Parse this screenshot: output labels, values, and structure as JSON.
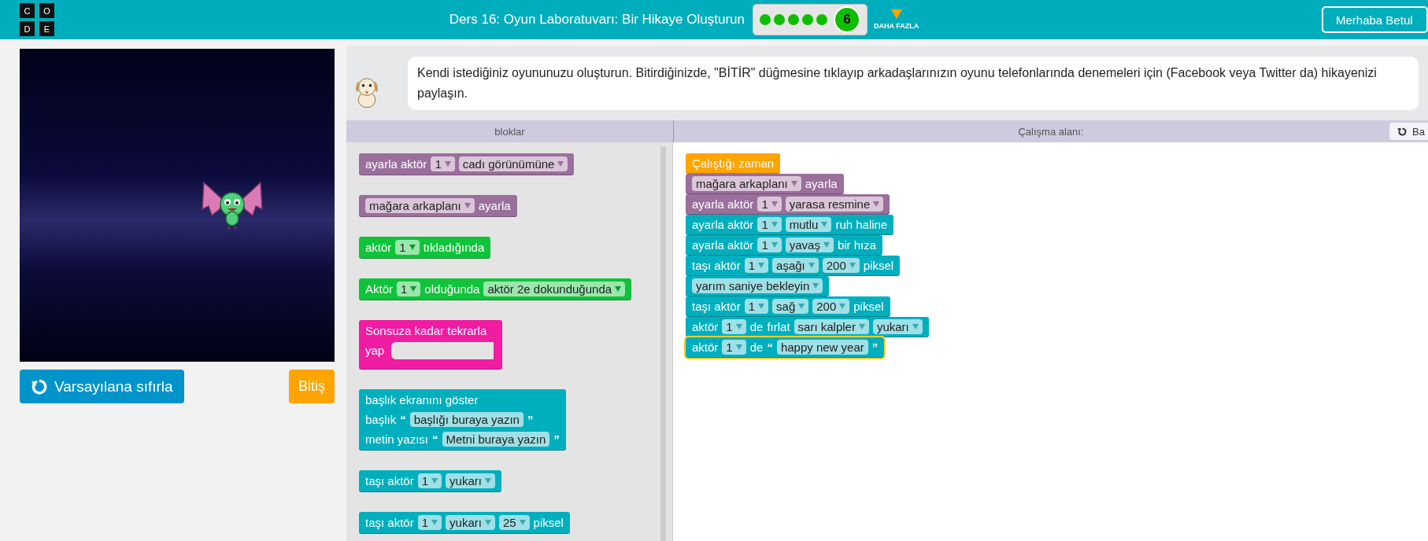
{
  "header": {
    "logo_letters": [
      "C",
      "O",
      "D",
      "E"
    ],
    "title": "Ders 16: Oyun Laboratuvarı: Bir Hikaye Oluşturun",
    "progress": {
      "dots": [
        {
          "completed": true
        },
        {
          "completed": true
        },
        {
          "completed": true
        },
        {
          "completed": true
        },
        {
          "completed": true
        }
      ],
      "current": "6"
    },
    "more_label": "DAHA FAZLA",
    "user_button": "Merhaba Betul"
  },
  "game": {
    "reset_button": "Varsayılana sıfırla",
    "finish_button": "Bitiş"
  },
  "instructions": {
    "text": "Kendi istediğiniz oyununuzu oluşturun. Bitirdiğinizde, \"BİTİR\" düğmesine tıklayıp arkadaşlarınızın oyunu telefonlarında denemeleri için (Facebook veya Twitter da) hikayenizi paylaşın."
  },
  "toolbox": {
    "title": "bloklar",
    "blocks": [
      {
        "kind": "looks",
        "lines": [
          [
            {
              "kind": "text",
              "v": "ayarla aktör"
            },
            {
              "kind": "dropdown",
              "v": "1"
            },
            {
              "kind": "dropdown",
              "v": "cadı görünümüne"
            }
          ]
        ]
      },
      {
        "kind": "looks",
        "lines": [
          [
            {
              "kind": "dropdown",
              "v": "mağara arkaplanı"
            },
            {
              "kind": "text",
              "v": "ayarla"
            }
          ]
        ]
      },
      {
        "kind": "event",
        "lines": [
          [
            {
              "kind": "text",
              "v": "aktör"
            },
            {
              "kind": "dropdown",
              "v": "1"
            },
            {
              "kind": "text",
              "v": "tıkladığında"
            }
          ]
        ]
      },
      {
        "kind": "event",
        "lines": [
          [
            {
              "kind": "text",
              "v": "Aktör"
            },
            {
              "kind": "dropdown",
              "v": "1"
            },
            {
              "kind": "text",
              "v": "olduğunda"
            },
            {
              "kind": "dropdown",
              "v": "aktör 2e dokunduğunda"
            }
          ]
        ]
      },
      {
        "kind": "loop",
        "lines": [
          [
            {
              "kind": "text",
              "v": "Sonsuza kadar tekrarla"
            }
          ],
          [
            {
              "kind": "text",
              "v": "yap"
            }
          ]
        ]
      },
      {
        "kind": "action",
        "lines": [
          [
            {
              "kind": "text",
              "v": "başlık ekranını göster"
            }
          ],
          [
            {
              "kind": "text",
              "v": "başlık"
            },
            {
              "kind": "quote",
              "v": "“"
            },
            {
              "kind": "input",
              "v": "başlığı buraya yazın"
            },
            {
              "kind": "quote",
              "v": "”"
            }
          ],
          [
            {
              "kind": "text",
              "v": "metin yazısı"
            },
            {
              "kind": "quote",
              "v": "“"
            },
            {
              "kind": "input",
              "v": "Metni buraya yazın"
            },
            {
              "kind": "quote",
              "v": "”"
            }
          ]
        ]
      },
      {
        "kind": "action",
        "lines": [
          [
            {
              "kind": "text",
              "v": "taşı aktör"
            },
            {
              "kind": "dropdown",
              "v": "1"
            },
            {
              "kind": "dropdown",
              "v": "yukarı"
            }
          ]
        ]
      },
      {
        "kind": "action",
        "lines": [
          [
            {
              "kind": "text",
              "v": "taşı aktör"
            },
            {
              "kind": "dropdown",
              "v": "1"
            },
            {
              "kind": "dropdown",
              "v": "yukarı"
            },
            {
              "kind": "dropdown",
              "v": "25"
            },
            {
              "kind": "text",
              "v": "piksel"
            }
          ]
        ]
      }
    ]
  },
  "workspace": {
    "title": "Çalışma alanı:",
    "reset_button": "Ba",
    "blocks": [
      {
        "kind": "start",
        "selected": false,
        "lines": [
          [
            {
              "kind": "text",
              "v": "Çalıştığı zaman"
            }
          ]
        ]
      },
      {
        "kind": "looks",
        "selected": false,
        "lines": [
          [
            {
              "kind": "dropdown",
              "v": "mağara arkaplanı"
            },
            {
              "kind": "text",
              "v": "ayarla"
            }
          ]
        ]
      },
      {
        "kind": "looks",
        "selected": false,
        "lines": [
          [
            {
              "kind": "text",
              "v": "ayarla aktör"
            },
            {
              "kind": "dropdown",
              "v": "1"
            },
            {
              "kind": "dropdown",
              "v": "yarasa resmine"
            }
          ]
        ]
      },
      {
        "kind": "action",
        "selected": false,
        "lines": [
          [
            {
              "kind": "text",
              "v": "ayarla aktör"
            },
            {
              "kind": "dropdown",
              "v": "1"
            },
            {
              "kind": "dropdown",
              "v": "mutlu"
            },
            {
              "kind": "text",
              "v": "ruh haline"
            }
          ]
        ]
      },
      {
        "kind": "action",
        "selected": false,
        "lines": [
          [
            {
              "kind": "text",
              "v": "ayarla aktör"
            },
            {
              "kind": "dropdown",
              "v": "1"
            },
            {
              "kind": "dropdown",
              "v": "yavaş"
            },
            {
              "kind": "text",
              "v": "bir hıza"
            }
          ]
        ]
      },
      {
        "kind": "action",
        "selected": false,
        "lines": [
          [
            {
              "kind": "text",
              "v": "taşı aktör"
            },
            {
              "kind": "dropdown",
              "v": "1"
            },
            {
              "kind": "dropdown",
              "v": "aşağı"
            },
            {
              "kind": "dropdown",
              "v": "200"
            },
            {
              "kind": "text",
              "v": "piksel"
            }
          ]
        ]
      },
      {
        "kind": "action",
        "selected": false,
        "lines": [
          [
            {
              "kind": "dropdown",
              "v": "yarım saniye bekleyin"
            }
          ]
        ]
      },
      {
        "kind": "action",
        "selected": false,
        "lines": [
          [
            {
              "kind": "text",
              "v": "taşı aktör"
            },
            {
              "kind": "dropdown",
              "v": "1"
            },
            {
              "kind": "dropdown",
              "v": "sağ"
            },
            {
              "kind": "dropdown",
              "v": "200"
            },
            {
              "kind": "text",
              "v": "piksel"
            }
          ]
        ]
      },
      {
        "kind": "action",
        "selected": false,
        "lines": [
          [
            {
              "kind": "text",
              "v": "aktör"
            },
            {
              "kind": "dropdown",
              "v": "1"
            },
            {
              "kind": "text",
              "v": "de"
            },
            {
              "kind": "text",
              "v": "fırlat"
            },
            {
              "kind": "dropdown",
              "v": "sarı kalpler"
            },
            {
              "kind": "dropdown",
              "v": "yukarı"
            }
          ]
        ]
      },
      {
        "kind": "action",
        "selected": true,
        "lines": [
          [
            {
              "kind": "text",
              "v": "aktör"
            },
            {
              "kind": "dropdown",
              "v": "1"
            },
            {
              "kind": "text",
              "v": "de"
            },
            {
              "kind": "quote",
              "v": "“"
            },
            {
              "kind": "input",
              "v": "happy new year"
            },
            {
              "kind": "quote",
              "v": "”"
            }
          ]
        ]
      }
    ]
  }
}
